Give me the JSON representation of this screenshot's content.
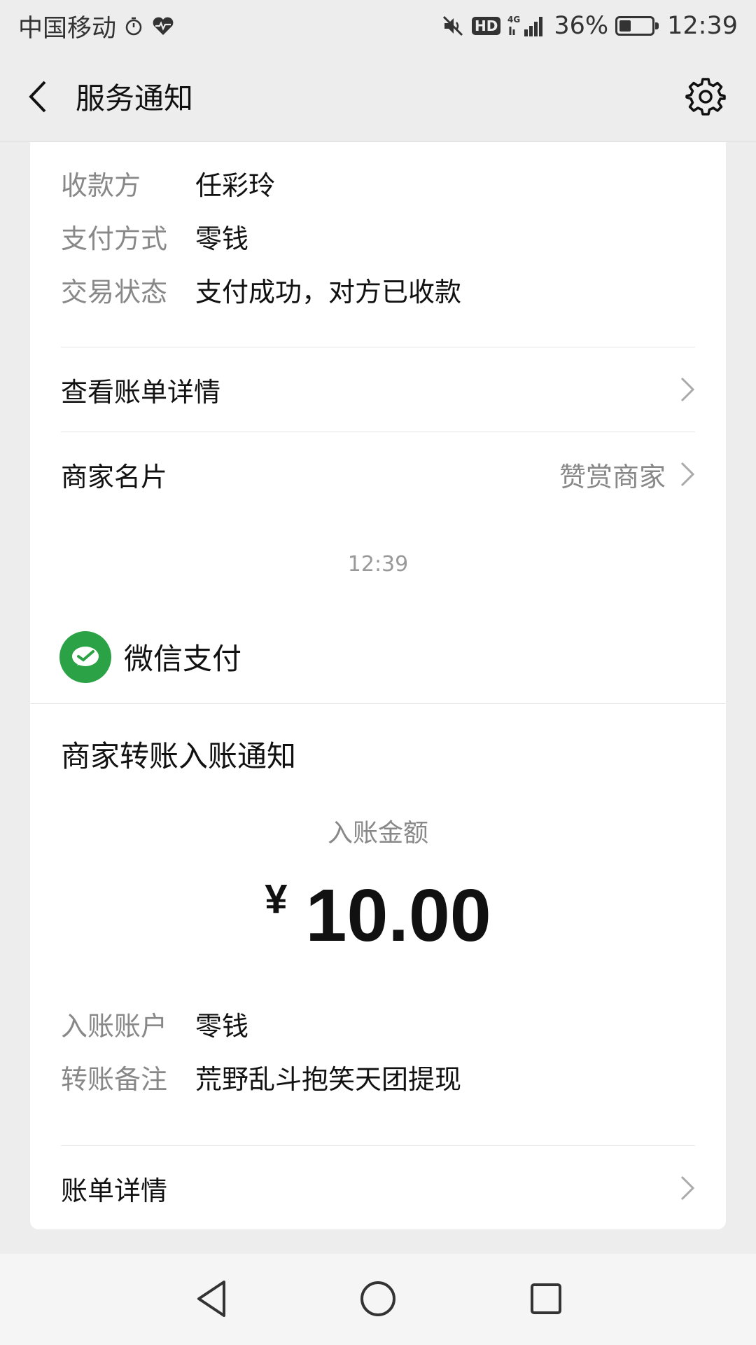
{
  "status_bar": {
    "carrier": "中国移动",
    "network": "4G",
    "hd": "HD",
    "battery_percent": "36%",
    "battery_level": 0.36,
    "time": "12:39"
  },
  "nav": {
    "title": "服务通知",
    "back_icon": "chevron-left-icon",
    "settings_icon": "gear-icon"
  },
  "payment_card": {
    "rows": [
      {
        "key": "收款方",
        "value": "任彩玲"
      },
      {
        "key": "支付方式",
        "value": "零钱"
      },
      {
        "key": "交易状态",
        "value": "支付成功，对方已收款"
      }
    ],
    "view_bill_label": "查看账单详情",
    "merchant_card_label": "商家名片",
    "reward_merchant_label": "赞赏商家"
  },
  "timestamp": "12:39",
  "transfer_card": {
    "header_title": "微信支付",
    "logo_icon": "wechat-pay-icon",
    "brand_color": "#2ba245",
    "notice_title": "商家转账入账通知",
    "amount_label": "入账金额",
    "currency": "¥",
    "amount": "10.00",
    "rows": [
      {
        "key": "入账账户",
        "value": "零钱"
      },
      {
        "key": "转账备注",
        "value": "荒野乱斗抱笑天团提现"
      }
    ],
    "bill_detail_label": "账单详情"
  },
  "bottom_nav": {
    "back": "triangle-back-icon",
    "home": "circle-home-icon",
    "recents": "square-recents-icon"
  }
}
